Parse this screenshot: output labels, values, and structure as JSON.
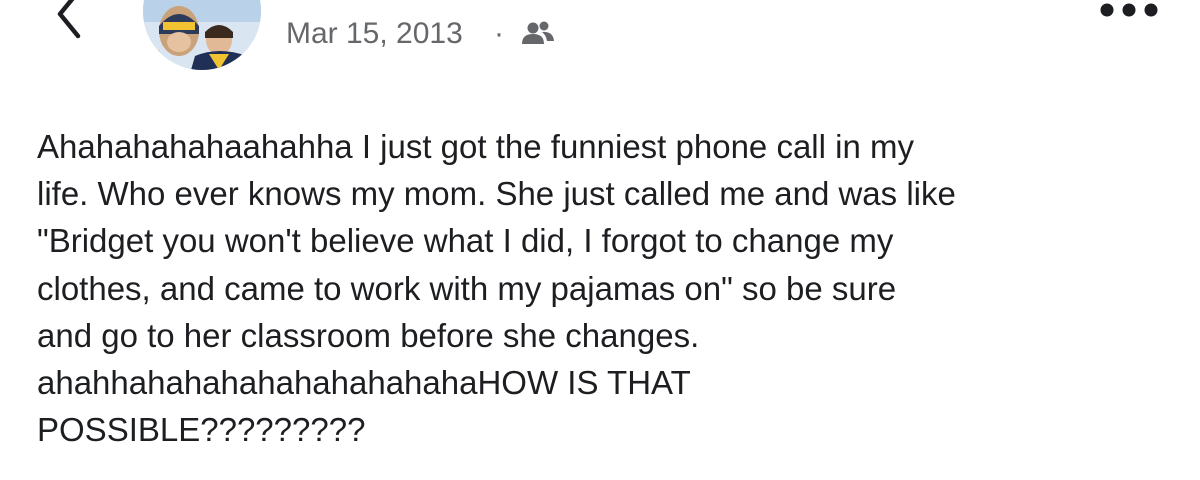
{
  "header": {
    "back_icon": "chevron-left-icon",
    "avatar": "profile-photo",
    "date": "Mar 15, 2013",
    "separator": "·",
    "audience_icon": "friends-icon",
    "more_icon": "ellipsis-icon"
  },
  "post": {
    "text": "Ahahahahahaahahha I just got the funniest phone call in my\nlife. Who ever knows my mom. She just called me and was like\n\"Bridget you won't believe what I did, I forgot to change my\nclothes, and came to work with my pajamas on\" so be sure\nand go to her classroom before she changes.\nahahhahahahahahahahahahaHOW IS THAT\nPOSSIBLE?????????"
  },
  "colors": {
    "text_primary": "#1c1e21",
    "text_secondary": "#65676b",
    "background": "#ffffff"
  }
}
